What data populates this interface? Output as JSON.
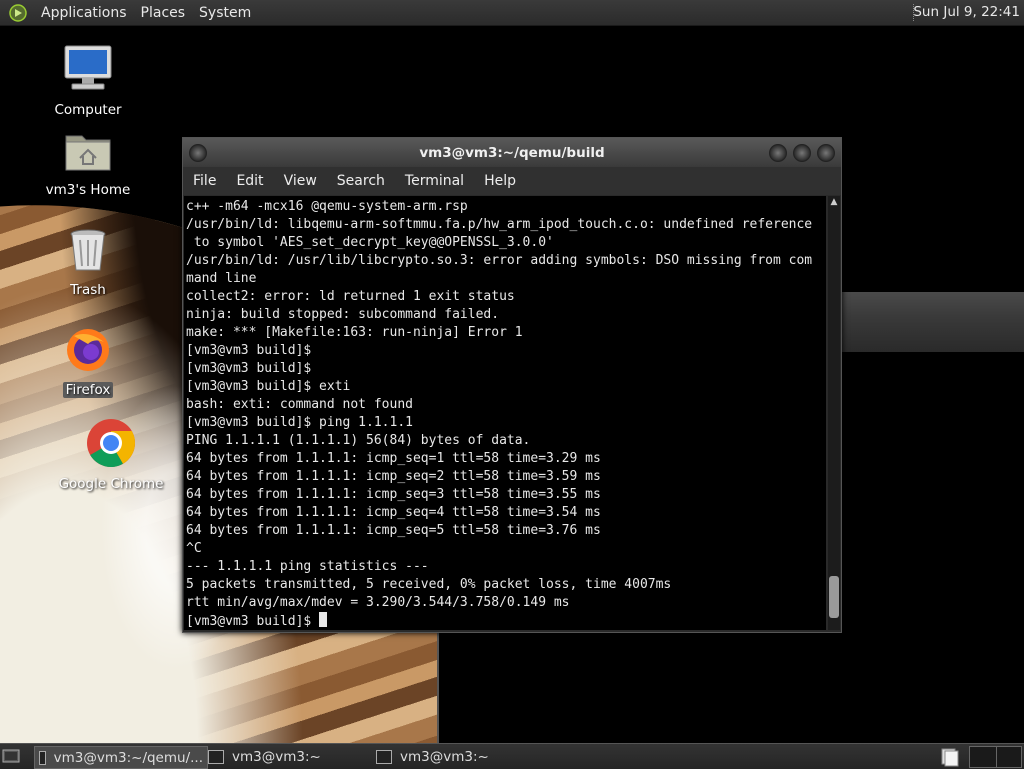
{
  "top_panel": {
    "menus": [
      "Applications",
      "Places",
      "System"
    ],
    "clock": "Sun Jul  9, 22:41"
  },
  "desktop": {
    "icons": [
      {
        "label": "Computer",
        "icon": "computer-icon"
      },
      {
        "label": "vm3's Home",
        "icon": "home-folder-icon"
      },
      {
        "label": "Trash",
        "icon": "trash-icon"
      },
      {
        "label": "Firefox",
        "icon": "firefox-icon"
      },
      {
        "label": "Google Chrome",
        "icon": "chrome-icon"
      }
    ]
  },
  "terminal": {
    "title": "vm3@vm3:~/qemu/build",
    "menu": [
      "File",
      "Edit",
      "View",
      "Search",
      "Terminal",
      "Help"
    ],
    "lines": [
      "c++ -m64 -mcx16 @qemu-system-arm.rsp",
      "/usr/bin/ld: libqemu-arm-softmmu.fa.p/hw_arm_ipod_touch.c.o: undefined reference",
      " to symbol 'AES_set_decrypt_key@@OPENSSL_3.0.0'",
      "/usr/bin/ld: /usr/lib/libcrypto.so.3: error adding symbols: DSO missing from com",
      "mand line",
      "collect2: error: ld returned 1 exit status",
      "ninja: build stopped: subcommand failed.",
      "make: *** [Makefile:163: run-ninja] Error 1",
      "[vm3@vm3 build]$",
      "[vm3@vm3 build]$",
      "[vm3@vm3 build]$ exti",
      "bash: exti: command not found",
      "[vm3@vm3 build]$ ping 1.1.1.1",
      "PING 1.1.1.1 (1.1.1.1) 56(84) bytes of data.",
      "64 bytes from 1.1.1.1: icmp_seq=1 ttl=58 time=3.29 ms",
      "64 bytes from 1.1.1.1: icmp_seq=2 ttl=58 time=3.59 ms",
      "64 bytes from 1.1.1.1: icmp_seq=3 ttl=58 time=3.55 ms",
      "64 bytes from 1.1.1.1: icmp_seq=4 ttl=58 time=3.54 ms",
      "64 bytes from 1.1.1.1: icmp_seq=5 ttl=58 time=3.76 ms",
      "^C",
      "--- 1.1.1.1 ping statistics ---",
      "5 packets transmitted, 5 received, 0% packet loss, time 4007ms",
      "rtt min/avg/max/mdev = 3.290/3.544/3.758/0.149 ms"
    ],
    "prompt": "[vm3@vm3 build]$ "
  },
  "taskbar": {
    "tasks": [
      {
        "label": "vm3@vm3:~/qemu/...",
        "active": true
      },
      {
        "label": "vm3@vm3:~",
        "active": false
      },
      {
        "label": "vm3@vm3:~",
        "active": false
      }
    ]
  }
}
